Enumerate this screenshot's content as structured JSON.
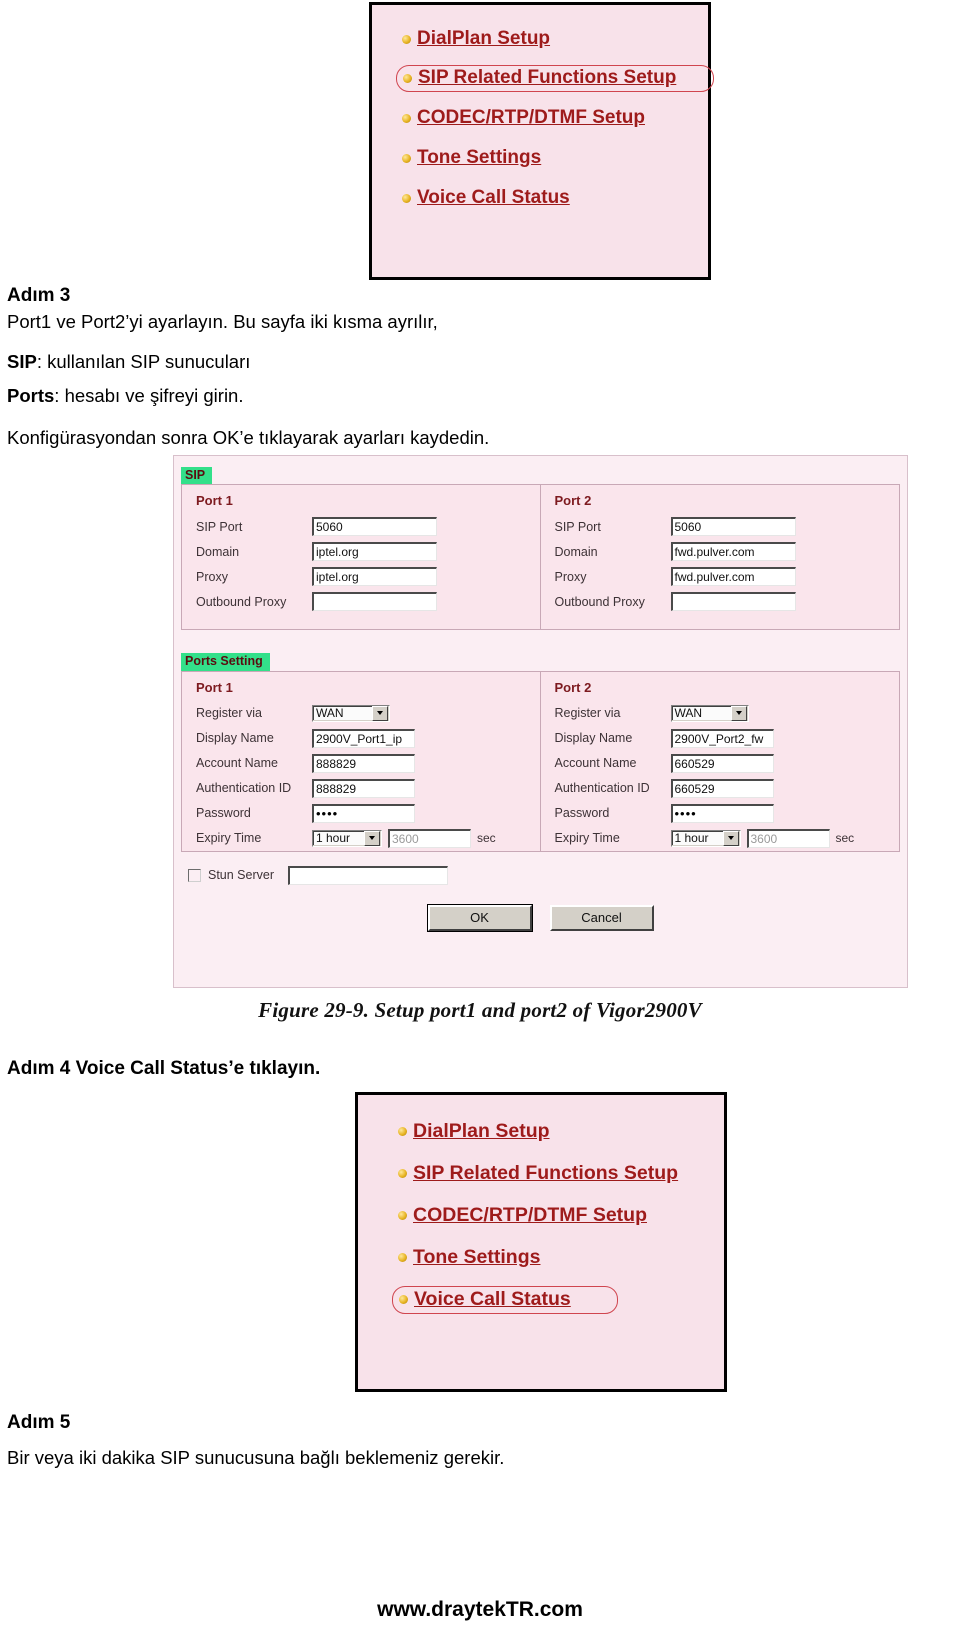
{
  "menu_top": {
    "items": [
      {
        "label": "DialPlan Setup",
        "highlighted": false
      },
      {
        "label": "SIP Related Functions Setup",
        "highlighted": true
      },
      {
        "label": "CODEC/RTP/DTMF Setup",
        "highlighted": false
      },
      {
        "label": "Tone Settings",
        "highlighted": false
      },
      {
        "label": "Voice Call Status",
        "highlighted": false
      }
    ]
  },
  "step3": {
    "heading": "Adım 3",
    "line1": "Port1 ve Port2’yi ayarlayın. Bu sayfa iki kısma ayrılır,",
    "line2_label": "SIP",
    "line2_rest": ": kullanılan SIP sunucuları",
    "line3_label": "Ports",
    "line3_rest": ": hesabı ve şifreyi girin.",
    "line4": "Konfigürasyondan sonra OK’e tıklayarak ayarları kaydedin."
  },
  "config": {
    "sip_tab": "SIP",
    "ports_tab": "Ports Setting",
    "sip": {
      "port1": {
        "title": "Port 1",
        "fields": [
          {
            "label": "SIP Port",
            "value": "5060"
          },
          {
            "label": "Domain",
            "value": "iptel.org"
          },
          {
            "label": "Proxy",
            "value": "iptel.org"
          },
          {
            "label": "Outbound Proxy",
            "value": ""
          }
        ]
      },
      "port2": {
        "title": "Port 2",
        "fields": [
          {
            "label": "SIP Port",
            "value": "5060"
          },
          {
            "label": "Domain",
            "value": "fwd.pulver.com"
          },
          {
            "label": "Proxy",
            "value": "fwd.pulver.com"
          },
          {
            "label": "Outbound Proxy",
            "value": ""
          }
        ]
      }
    },
    "ports_setting": {
      "port1": {
        "title": "Port 1",
        "register_via_label": "Register via",
        "register_via_value": "WAN",
        "display_name_label": "Display Name",
        "display_name_value": "2900V_Port1_ip",
        "account_name_label": "Account Name",
        "account_name_value": "888829",
        "auth_id_label": "Authentication ID",
        "auth_id_value": "888829",
        "password_label": "Password",
        "password_value": "••••",
        "expiry_label": "Expiry Time",
        "expiry_select": "1 hour",
        "expiry_seconds": "3600",
        "expiry_unit": "sec"
      },
      "port2": {
        "title": "Port 2",
        "register_via_label": "Register via",
        "register_via_value": "WAN",
        "display_name_label": "Display Name",
        "display_name_value": "2900V_Port2_fw",
        "account_name_label": "Account Name",
        "account_name_value": "660529",
        "auth_id_label": "Authentication ID",
        "auth_id_value": "660529",
        "password_label": "Password",
        "password_value": "••••",
        "expiry_label": "Expiry Time",
        "expiry_select": "1 hour",
        "expiry_seconds": "3600",
        "expiry_unit": "sec"
      }
    },
    "stun_label": "Stun Server",
    "stun_value": "",
    "ok_label": "OK",
    "cancel_label": "Cancel"
  },
  "figure_caption": "Figure 29-9. Setup port1 and port2 of Vigor2900V",
  "step4": {
    "heading": "Adım 4 Voice Call Status’e tıklayın."
  },
  "menu_bottom": {
    "items": [
      {
        "label": "DialPlan Setup",
        "highlighted": false
      },
      {
        "label": "SIP Related Functions Setup",
        "highlighted": false
      },
      {
        "label": "CODEC/RTP/DTMF Setup",
        "highlighted": false
      },
      {
        "label": "Tone Settings",
        "highlighted": false
      },
      {
        "label": "Voice Call Status",
        "highlighted": true
      }
    ]
  },
  "step5": {
    "heading": "Adım 5",
    "line1": "Bir veya iki dakika SIP sunucusuna bağlı beklemeniz gerekir."
  },
  "footer": {
    "url": "www.draytekTR.com"
  },
  "colors": {
    "menu_bg": "#f8e2ea",
    "link_red": "#9e1b1b",
    "highlight_border": "#d0454f",
    "tab_green": "#33e08a",
    "config_bg": "#fbeef3"
  }
}
